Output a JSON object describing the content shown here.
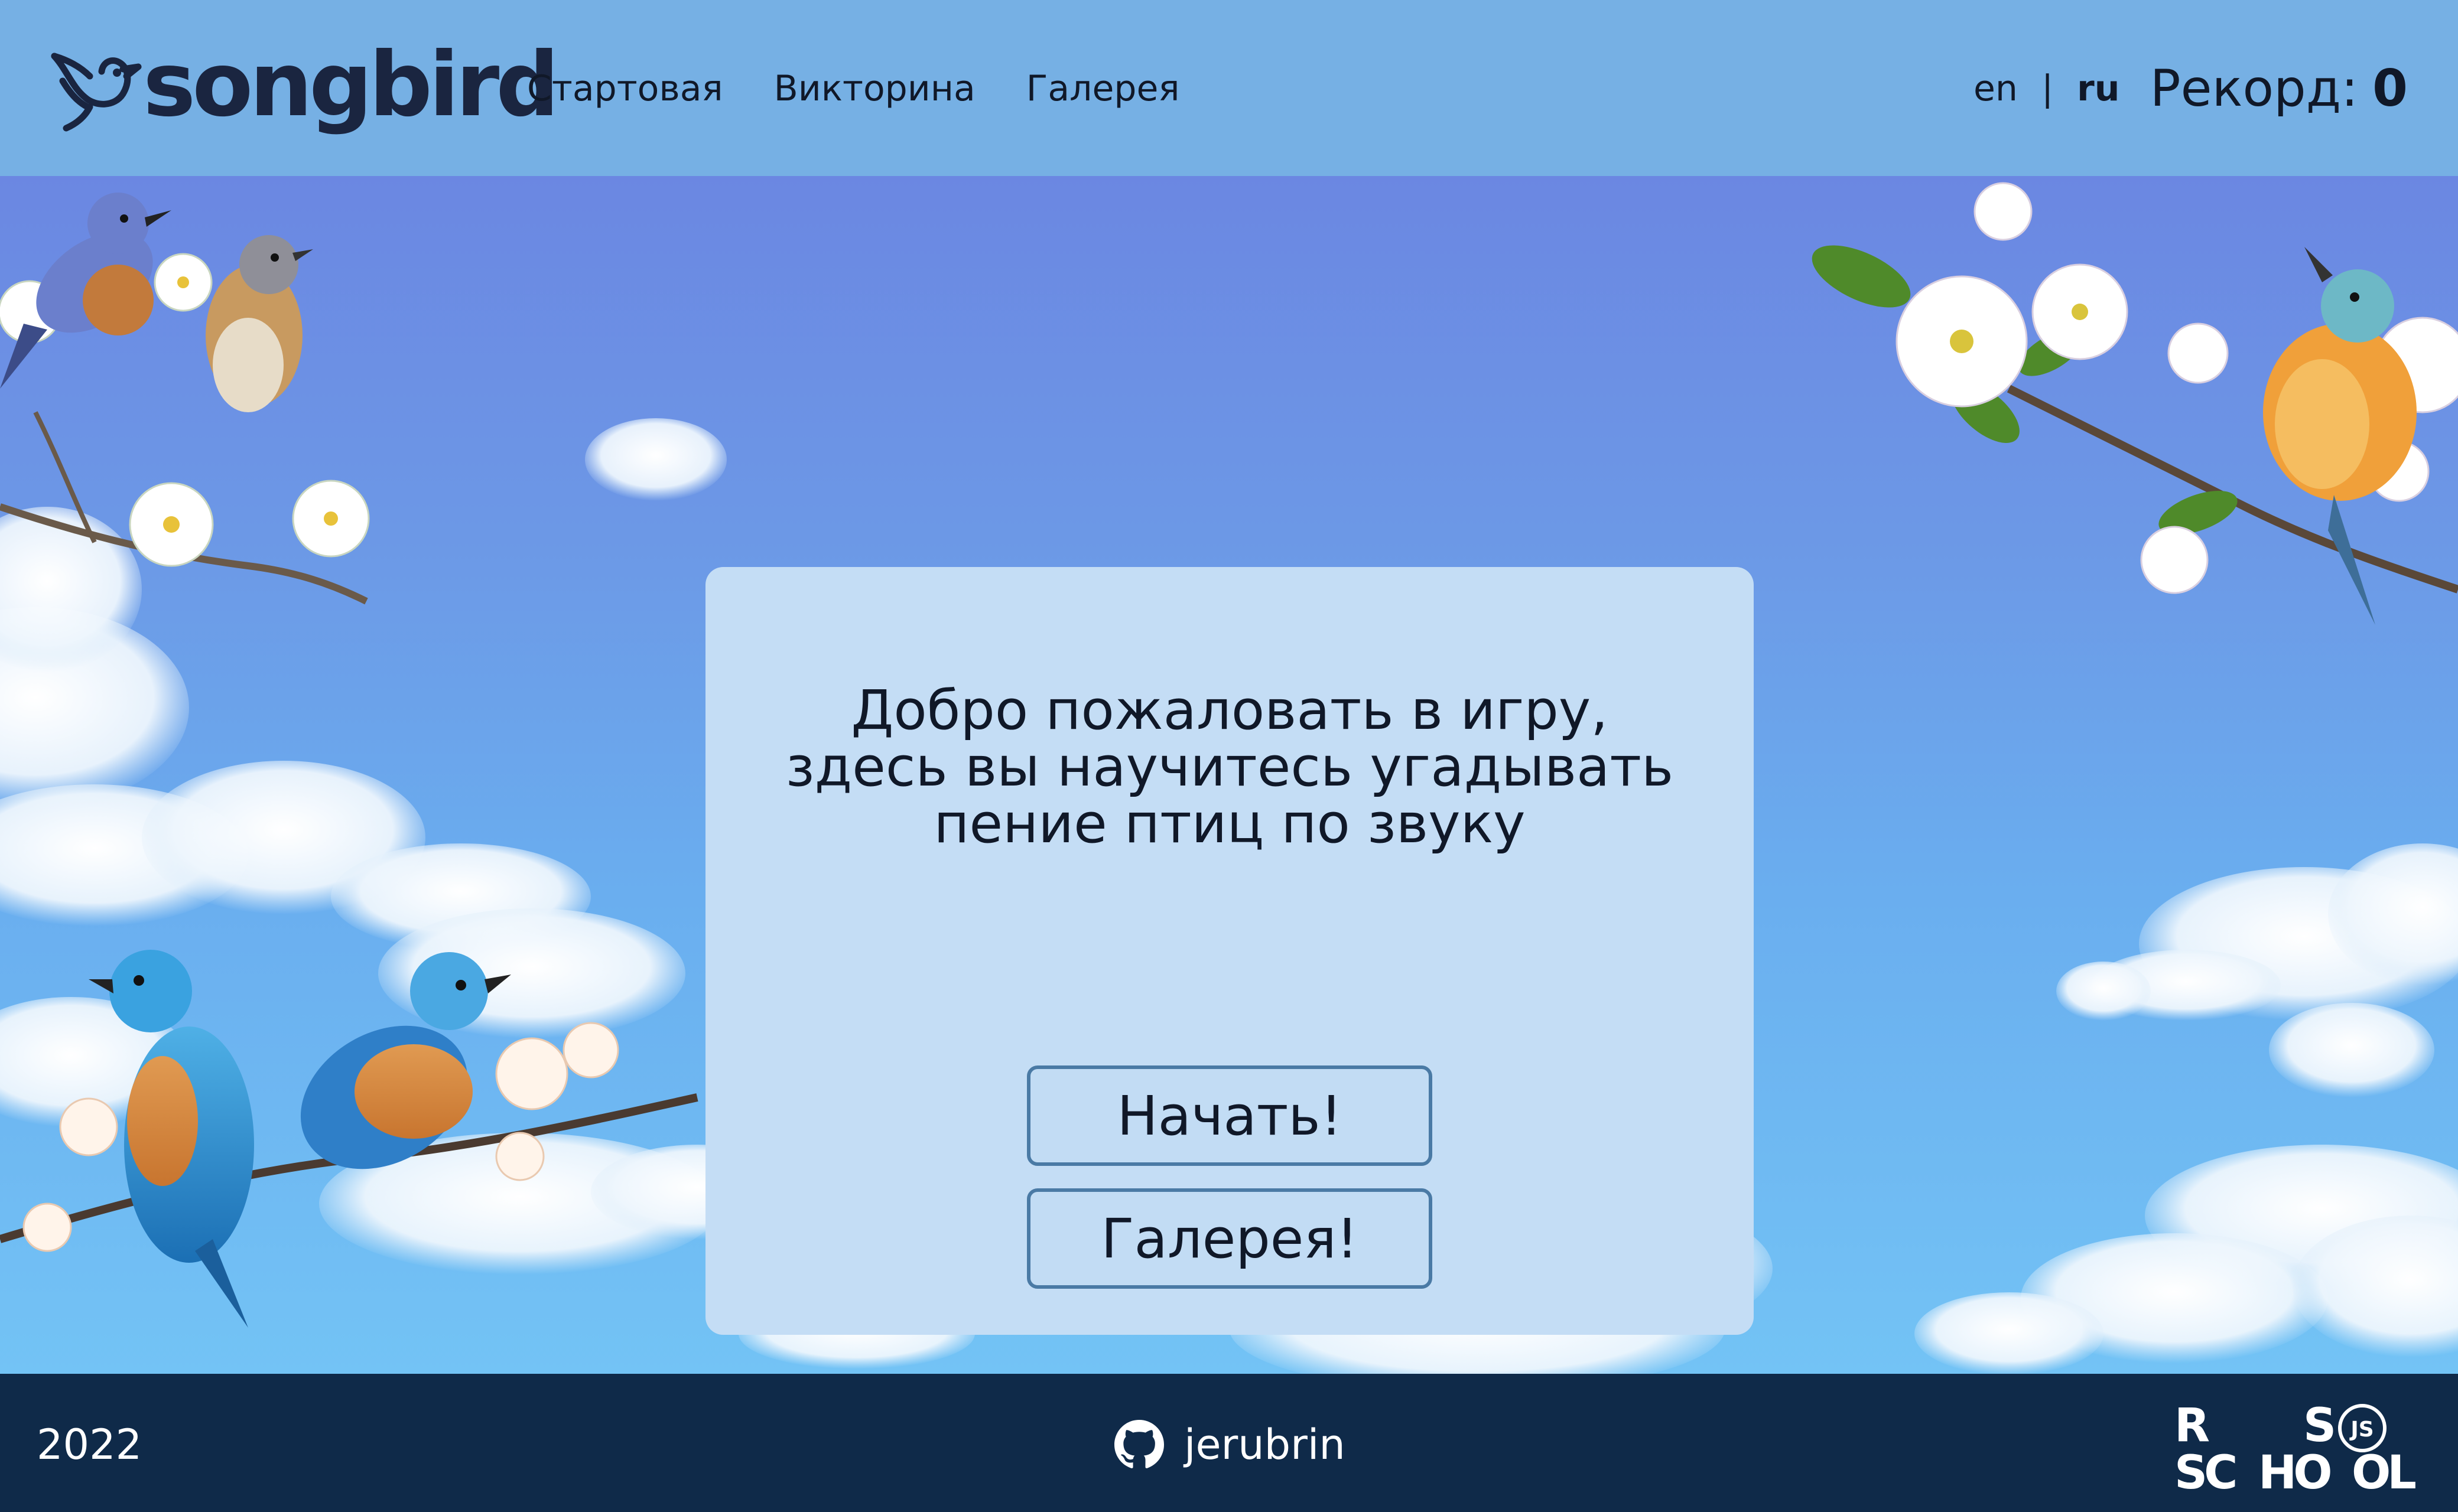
{
  "header": {
    "logo_text": "songbird",
    "nav": [
      {
        "label": "Стартовая"
      },
      {
        "label": "Викторина"
      },
      {
        "label": "Галерея"
      }
    ],
    "lang": {
      "en": "en",
      "separator": "|",
      "ru": "ru",
      "active": "ru"
    },
    "record": {
      "label": "Рекорд:",
      "value": "0"
    }
  },
  "card": {
    "welcome_text": "Добро пожаловать в игру, здесь вы научитесь угадывать пение птиц по звуку",
    "start_button": "Начать!",
    "gallery_button": "Галерея!"
  },
  "footer": {
    "year": "2022",
    "github_user": "jerubrin",
    "school_logo_text": "RS SCHOOL JS"
  },
  "colors": {
    "header_bg": "#76b0e4",
    "card_bg": "#c4ddf5",
    "button_border": "#4a7aa5",
    "footer_bg": "#0f2a49",
    "text": "#101828"
  },
  "icons": {
    "logo": "bird-icon",
    "github": "github-icon"
  }
}
